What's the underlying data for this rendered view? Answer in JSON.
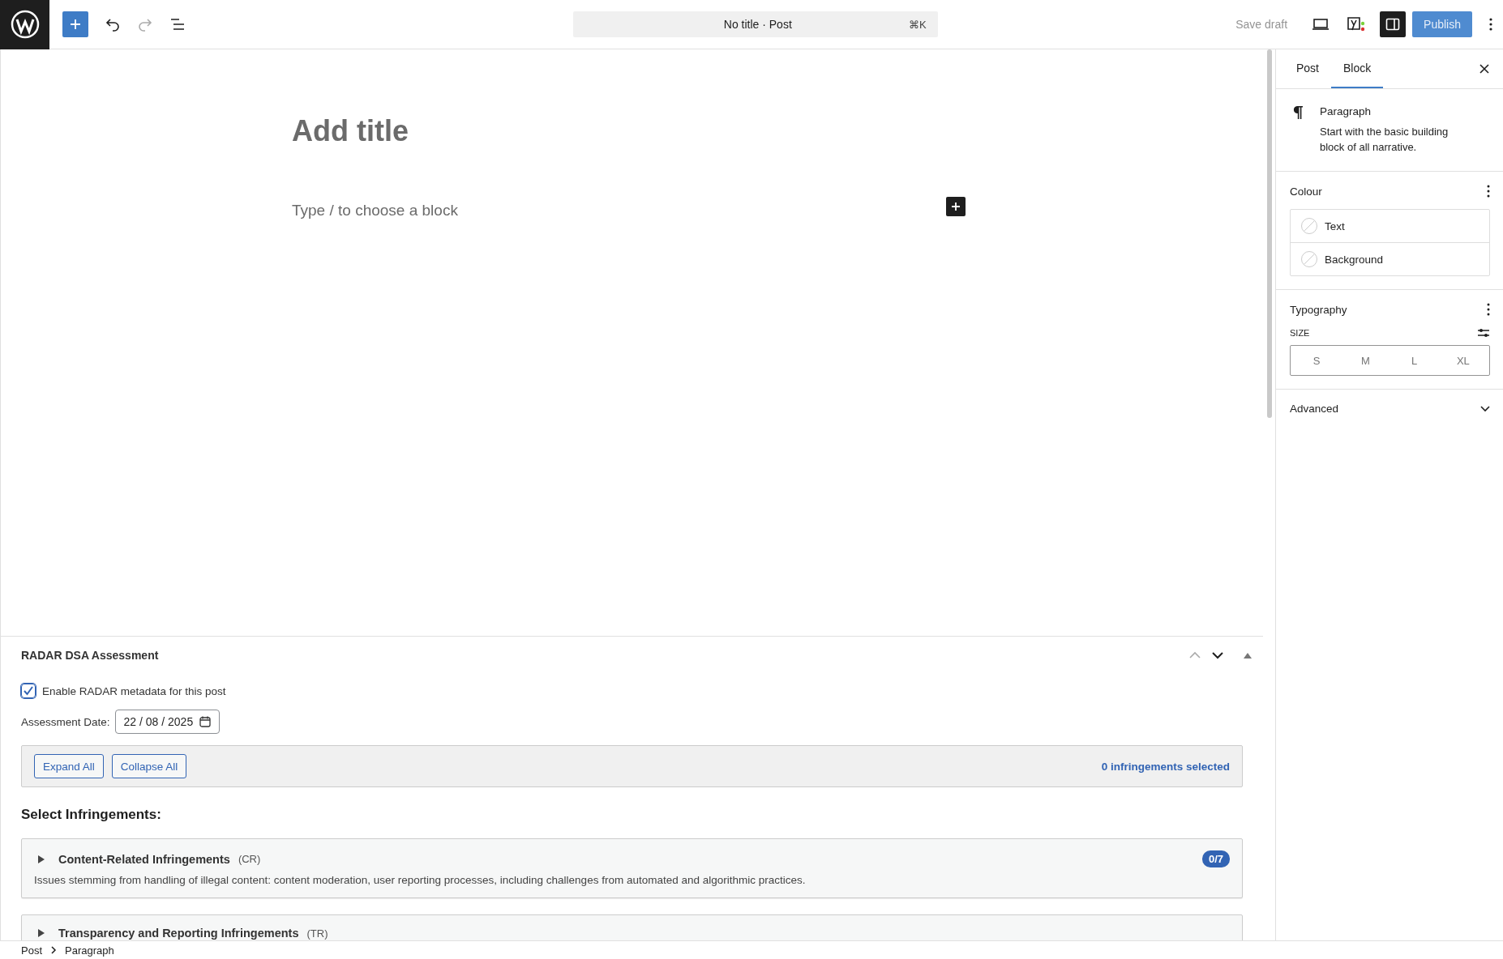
{
  "toolbar": {
    "title": "No title · Post",
    "shortcut": "⌘K",
    "save_draft": "Save draft",
    "publish": "Publish"
  },
  "editor": {
    "title_placeholder": "Add title",
    "block_placeholder": "Type / to choose a block"
  },
  "meta_box": {
    "title": "RADAR DSA Assessment",
    "enable": {
      "label": "Enable RADAR metadata for this post",
      "checked": true
    },
    "date": {
      "label": "Assessment Date:",
      "value": "22 / 08 / 2025"
    },
    "buttons": [
      "Expand All",
      "Collapse All"
    ],
    "selected_count": "0 infringements selected",
    "heading": "Select Infringements:",
    "categories": [
      {
        "title": "Content-Related Infringements",
        "code": "(CR)",
        "count": "0/7",
        "description": "Issues stemming from handling of illegal content: content moderation, user reporting processes, including challenges from automated and algorithmic practices.",
        "expanded": false
      },
      {
        "title": "Transparency and Reporting Infringements",
        "code": "(TR)",
        "expanded": false
      }
    ]
  },
  "sidebar": {
    "tabs": [
      {
        "label": "Post",
        "selected": false
      },
      {
        "label": "Block",
        "selected": true
      }
    ],
    "block": {
      "name": "Paragraph",
      "description": "Start with the basic building block of all narrative."
    },
    "colour": {
      "title": "Colour",
      "items": [
        "Text",
        "Background"
      ]
    },
    "typography": {
      "title": "Typography",
      "size_label": "SIZE",
      "sizes": [
        {
          "label": "S",
          "selected": false
        },
        {
          "label": "M",
          "selected": false
        },
        {
          "label": "L",
          "selected": false
        },
        {
          "label": "XL",
          "selected": false
        }
      ]
    },
    "advanced": {
      "title": "Advanced",
      "expanded": false
    }
  },
  "breadcrumb": [
    "Post",
    "Paragraph"
  ]
}
